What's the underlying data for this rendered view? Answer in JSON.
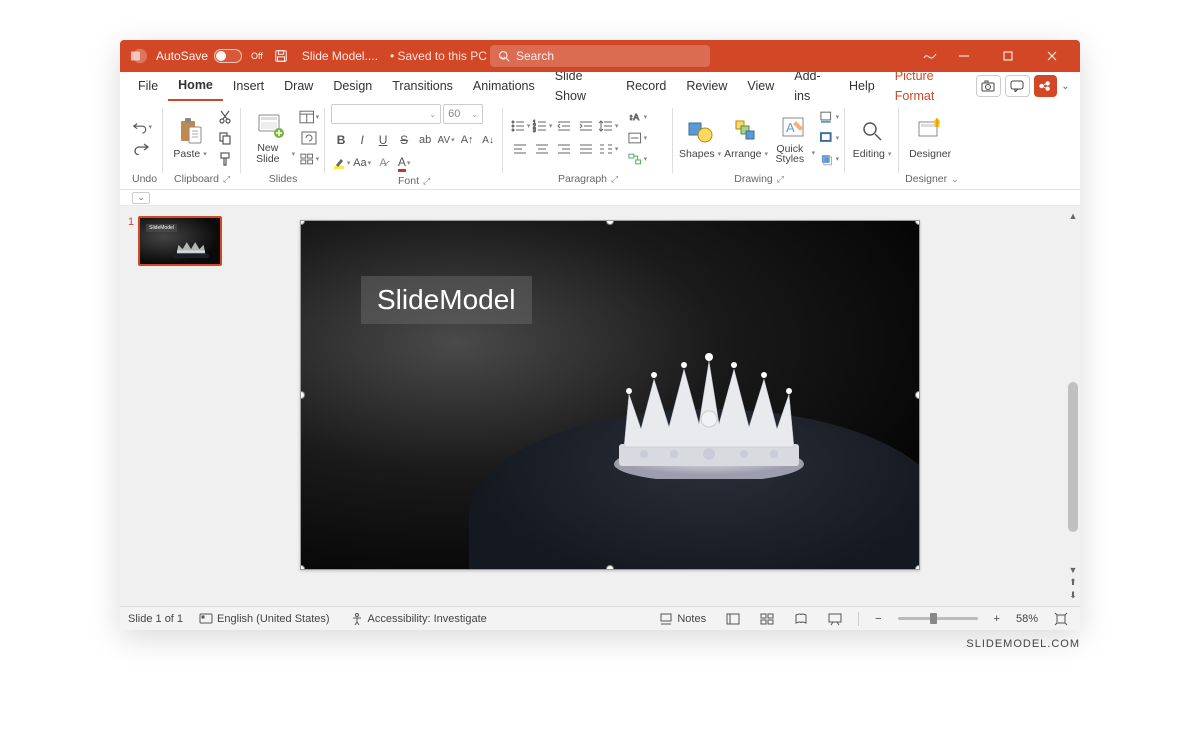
{
  "titlebar": {
    "autosave_label": "AutoSave",
    "autosave_state": "Off",
    "doc_name": "Slide Model....",
    "saved_status": "Saved to this PC",
    "search_placeholder": "Search"
  },
  "menu": {
    "file": "File",
    "home": "Home",
    "insert": "Insert",
    "draw": "Draw",
    "design": "Design",
    "transitions": "Transitions",
    "animations": "Animations",
    "slideshow": "Slide Show",
    "record": "Record",
    "review": "Review",
    "view": "View",
    "addins": "Add-ins",
    "help": "Help",
    "picture_format": "Picture Format"
  },
  "ribbon": {
    "undo_group": "Undo",
    "clipboard_group": "Clipboard",
    "paste": "Paste",
    "slides_group": "Slides",
    "new_slide": "New Slide",
    "font_group": "Font",
    "font_size_placeholder": "60",
    "paragraph_group": "Paragraph",
    "drawing_group": "Drawing",
    "shapes": "Shapes",
    "arrange": "Arrange",
    "quick_styles": "Quick Styles",
    "editing": "Editing",
    "designer_group": "Designer",
    "designer": "Designer"
  },
  "thumbnails": {
    "slide1_num": "1",
    "slide1_text": "SlideModel"
  },
  "slide": {
    "watermark": "SlideModel"
  },
  "statusbar": {
    "slide_pos": "Slide 1 of 1",
    "language": "English (United States)",
    "accessibility": "Accessibility: Investigate",
    "notes": "Notes",
    "zoom_pct": "58%"
  },
  "attribution": "SLIDEMODEL.COM"
}
